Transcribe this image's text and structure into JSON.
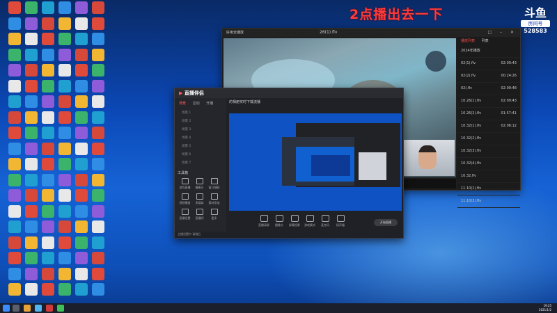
{
  "overlay_text": "2点播出去一下",
  "logo": {
    "brand": "斗鱼",
    "room_label": "房间号",
    "room_number": "528583"
  },
  "player": {
    "window_title": "好用全播放",
    "current_file": "26(1).flv",
    "playlist_tabs": [
      "播放列表",
      "列表"
    ],
    "playlist_header": "2024年播放",
    "playlist": [
      {
        "name": "02(1).flv",
        "duration": "02:09:43"
      },
      {
        "name": "02(2).flv",
        "duration": "00:24:26"
      },
      {
        "name": "02(.flv",
        "duration": "02:09:48"
      },
      {
        "name": "10.26(1).flv",
        "duration": "02:09:43"
      },
      {
        "name": "10.26(2).flv",
        "duration": "01:57:41"
      },
      {
        "name": "10.32(1).flv",
        "duration": "02:06:12"
      },
      {
        "name": "10.32(2).flv",
        "duration": ""
      },
      {
        "name": "10.32(3).flv",
        "duration": ""
      },
      {
        "name": "10.32(4).flv",
        "duration": ""
      },
      {
        "name": "10.32.flv",
        "duration": ""
      },
      {
        "name": "11.10(1).flv",
        "duration": ""
      },
      {
        "name": "11.10(2).flv",
        "duration": ""
      }
    ]
  },
  "obs": {
    "app_name": "直播伴侣",
    "tabs": [
      "场景",
      "互动",
      "开播"
    ],
    "scenes": [
      "场景 1",
      "场景 2",
      "场景 3",
      "场景 4",
      "场景 5",
      "场景 6",
      "场景 7"
    ],
    "tools_title": "工具箱",
    "tools": [
      "游戏直播",
      "摄像头",
      "窗口捕获",
      "视频播放",
      "多媒体",
      "素材添加",
      "直播设置",
      "直播间",
      "更多"
    ],
    "header_title": "的相册实时下载流播",
    "bottom_buttons": [
      "直播录屏",
      "摄像头",
      "屏幕投影",
      "游戏模式",
      "麦克风",
      "扬声器"
    ],
    "start_label": "开始直播",
    "status": "主播设置中 请稍后"
  },
  "taskbar": {
    "time": "19:25",
    "date": "2021/1/2"
  }
}
